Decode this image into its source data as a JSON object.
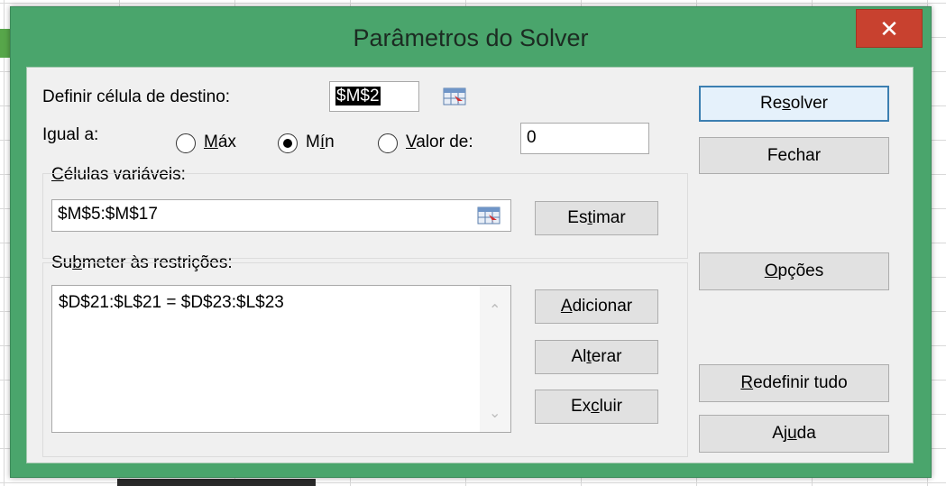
{
  "dialog": {
    "title": "Parâmetros do Solver",
    "close_glyph": "✕"
  },
  "target": {
    "label_pre": "Definir célula de destino:",
    "value": "$M$2",
    "ref_icon": "range-select-icon"
  },
  "equal_to": {
    "label": "Igual a:",
    "options": [
      {
        "label_pre": "",
        "label_u": "M",
        "label_post": "áx",
        "checked": false
      },
      {
        "label_pre": "M",
        "label_u": "í",
        "label_post": "n",
        "checked": true
      },
      {
        "label_pre": "",
        "label_u": "V",
        "label_post": "alor de:",
        "checked": false
      }
    ],
    "value_input": "0"
  },
  "variable_cells": {
    "label_u": "C",
    "label_post": "élulas variáveis:",
    "value": "$M$5:$M$17",
    "ref_icon": "range-select-icon",
    "guess_pre": "Es",
    "guess_u": "t",
    "guess_post": "imar"
  },
  "constraints": {
    "label_pre": "Su",
    "label_u": "b",
    "label_post": "meter às restrições:",
    "items": [
      "$D$21:$L$21 = $D$23:$L$23"
    ],
    "add": {
      "pre": "",
      "u": "A",
      "post": "dicionar"
    },
    "change": {
      "pre": "Al",
      "u": "t",
      "post": "erar"
    },
    "delete": {
      "pre": "Ex",
      "u": "c",
      "post": "luir"
    }
  },
  "side_buttons": {
    "solve": {
      "pre": "Re",
      "u": "s",
      "post": "olver"
    },
    "close": {
      "pre": "Fechar",
      "u": "",
      "post": ""
    },
    "options": {
      "pre": "",
      "u": "O",
      "post": "pções"
    },
    "reset": {
      "pre": "",
      "u": "R",
      "post": "edefinir tudo"
    },
    "help": {
      "pre": "Aj",
      "u": "u",
      "post": "da"
    }
  }
}
